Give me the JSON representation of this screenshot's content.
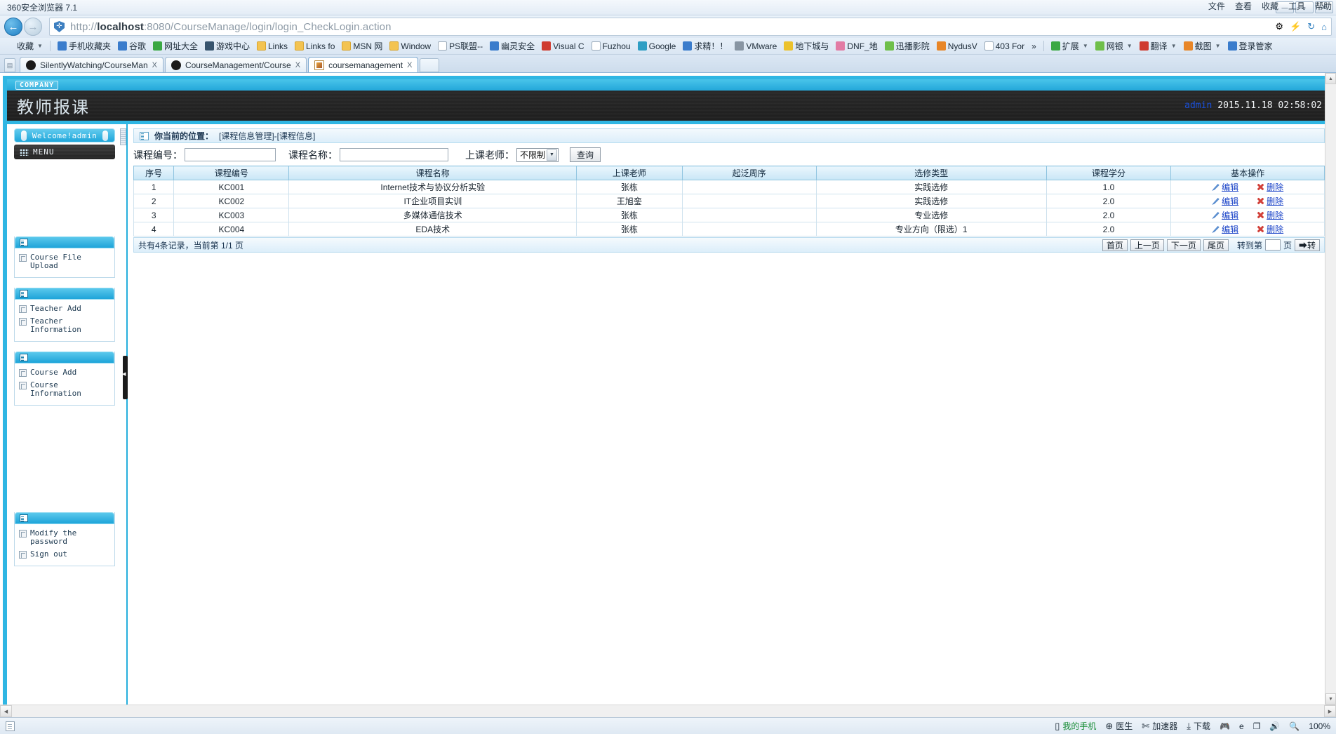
{
  "browser": {
    "title": "360安全浏览器 7.1",
    "url_prefix": "http://",
    "url_host": "localhost",
    "url_rest": ":8080/CourseManage/login/login_CheckLogin.action",
    "window_buttons": [
      "—",
      "▫",
      "✕"
    ],
    "menus": [
      "文件",
      "查看",
      "收藏",
      "工具",
      "帮助"
    ],
    "bookmarks": [
      {
        "label": "收藏",
        "icon": "star-icon",
        "cls": "ic-star",
        "caret": true
      },
      {
        "label": "手机收藏夹",
        "icon": "phone-icon",
        "cls": "ic-blue"
      },
      {
        "label": "谷歌",
        "icon": "google-icon",
        "cls": "ic-blue"
      },
      {
        "label": "网址大全",
        "icon": "plus-icon",
        "cls": "ic-green"
      },
      {
        "label": "游戏中心",
        "icon": "gamepad-icon",
        "cls": "ic-dark"
      },
      {
        "label": "Links",
        "icon": "folder-icon",
        "cls": "ic-folder"
      },
      {
        "label": "Links fo",
        "icon": "folder-icon",
        "cls": "ic-folder"
      },
      {
        "label": "MSN 网",
        "icon": "folder-icon",
        "cls": "ic-folder"
      },
      {
        "label": "Window",
        "icon": "folder-icon",
        "cls": "ic-folder"
      },
      {
        "label": "PS联盟--",
        "icon": "page-icon",
        "cls": "ic-page"
      },
      {
        "label": "幽灵安全",
        "icon": "ghost-icon",
        "cls": "ic-blue"
      },
      {
        "label": "Visual C",
        "icon": "visualc-icon",
        "cls": "ic-red"
      },
      {
        "label": "Fuzhou",
        "icon": "page-icon",
        "cls": "ic-page"
      },
      {
        "label": "Google",
        "icon": "google-icon",
        "cls": "ic-teal"
      },
      {
        "label": "求精！！",
        "icon": "baidu-icon",
        "cls": "ic-blue"
      },
      {
        "label": "VMware",
        "icon": "vmware-icon",
        "cls": "ic-gray"
      },
      {
        "label": "地下城与",
        "icon": "dnf-icon",
        "cls": "ic-yellow"
      },
      {
        "label": "DNF_地",
        "icon": "dnf-icon",
        "cls": "ic-pink"
      },
      {
        "label": "迅播影院",
        "icon": "play-icon",
        "cls": "ic-lgreen"
      },
      {
        "label": "NydusV",
        "icon": "nydus-icon",
        "cls": "ic-orange"
      },
      {
        "label": "403 For",
        "icon": "page-icon",
        "cls": "ic-page"
      }
    ],
    "bookmarks_overflow": "»",
    "toolbar_right": [
      {
        "label": "扩展",
        "icon": "extension-icon",
        "cls": "ic-green",
        "caret": true
      },
      {
        "label": "网银",
        "icon": "bank-icon",
        "cls": "ic-lgreen",
        "caret": true
      },
      {
        "label": "翻译",
        "icon": "translate-icon",
        "cls": "ic-red",
        "caret": true
      },
      {
        "label": "截图",
        "icon": "screenshot-icon",
        "cls": "ic-orange",
        "caret": true
      },
      {
        "label": "登录管家",
        "icon": "login-manager-icon",
        "cls": "ic-blue",
        "caret": false
      }
    ],
    "tabs": [
      {
        "label": "SilentlyWatching/CourseMan",
        "favicon": "github-icon",
        "active": false,
        "close": "X"
      },
      {
        "label": "CourseManagement/Course",
        "favicon": "github-icon",
        "active": false,
        "close": "X"
      },
      {
        "label": "coursemanagement",
        "favicon": "tomcat-icon",
        "active": true,
        "close": "X"
      }
    ]
  },
  "page": {
    "company_badge": "COMPANY",
    "site_title": "教师报课",
    "user": "admin",
    "datetime": "2015.11.18 02:58:02"
  },
  "sidebar": {
    "welcome": "Welcome!admin",
    "menu_label": "MENU",
    "groups": [
      {
        "items": [
          {
            "label": "Course File Upload"
          }
        ]
      },
      {
        "items": [
          {
            "label": "Teacher Add"
          },
          {
            "label": "Teacher Information"
          }
        ]
      },
      {
        "items": [
          {
            "label": "Course Add"
          },
          {
            "label": "Course Information"
          }
        ]
      },
      {
        "items": [
          {
            "label": "Modify the password"
          },
          {
            "label": "Sign out"
          }
        ]
      }
    ]
  },
  "main": {
    "breadcrumb_label": "你当前的位置：",
    "breadcrumb_path": "[课程信息管理]-[课程信息]",
    "search": {
      "code_label": "课程编号：",
      "code_value": "",
      "name_label": "课程名称：",
      "name_value": "",
      "teacher_label": "上课老师：",
      "teacher_selected": "不限制",
      "teacher_options": [
        "不限制"
      ],
      "submit_label": "查询"
    },
    "table": {
      "columns": [
        "序号",
        "课程编号",
        "课程名称",
        "上课老师",
        "起泛周序",
        "选修类型",
        "课程学分",
        "基本操作"
      ],
      "rows": [
        {
          "no": "1",
          "code": "KC001",
          "name": "Internet技术与协议分析实验",
          "teacher": "张栋",
          "week": "",
          "type": "实践选修",
          "credit": "1.0"
        },
        {
          "no": "2",
          "code": "KC002",
          "name": "IT企业项目实训",
          "teacher": "王旭銮",
          "week": "",
          "type": "实践选修",
          "credit": "2.0"
        },
        {
          "no": "3",
          "code": "KC003",
          "name": "多媒体通信技术",
          "teacher": "张栋",
          "week": "",
          "type": "专业选修",
          "credit": "2.0"
        },
        {
          "no": "4",
          "code": "KC004",
          "name": "EDA技术",
          "teacher": "张栋",
          "week": "",
          "type": "专业方向（限选）1",
          "credit": "2.0"
        }
      ],
      "edit_label": "编辑",
      "delete_label": "删除"
    },
    "pager": {
      "summary": "共有4条记录，当前第 1/1 页",
      "first": "首页",
      "prev": "上一页",
      "next": "下一页",
      "last": "尾页",
      "jump_prefix": "转到第",
      "jump_value": "",
      "jump_suffix": "页",
      "go": "➡转"
    }
  },
  "taskbar": {
    "items": [
      {
        "label": "我的手机",
        "icon": "phone-icon"
      },
      {
        "label": "医生",
        "icon": "doctor-icon"
      },
      {
        "label": "加速器",
        "icon": "rocket-icon"
      },
      {
        "label": "下载",
        "icon": "download-icon"
      }
    ],
    "right_icons": [
      "game-icon",
      "ie-icon",
      "window-icon",
      "sound-icon",
      "zoom-icon"
    ],
    "zoom": "100%"
  }
}
